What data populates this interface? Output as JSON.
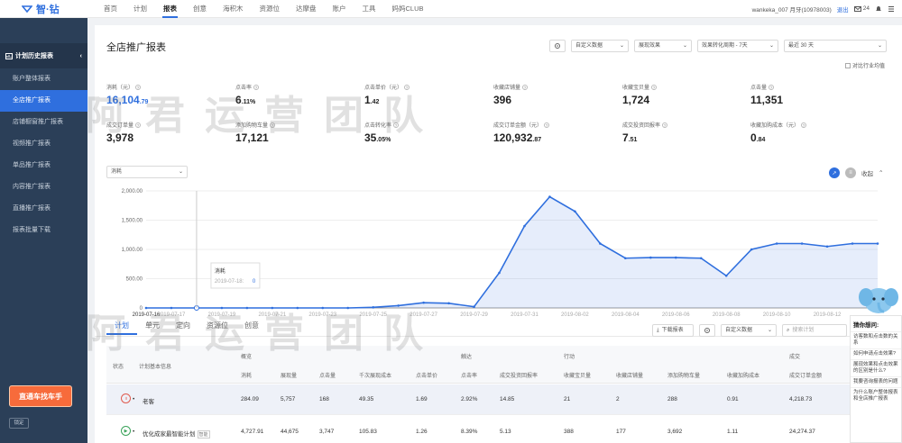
{
  "logo": {
    "text": "智·钻"
  },
  "nav": [
    "首页",
    "计划",
    "报表",
    "创意",
    "海积木",
    "资源位",
    "达摩盘",
    "账户",
    "工具",
    "妈妈CLUB"
  ],
  "nav_active": 2,
  "user": {
    "name": "wankeka_007 月牙(10978003)",
    "logout": "退出",
    "mail_count": "24"
  },
  "sidebar": {
    "heading": "计划历史报表",
    "items": [
      "账户整体报表",
      "全店推广报表",
      "店铺橱窗推广报表",
      "视频推广报表",
      "单品推广报表",
      "内容推广报表",
      "直播推广报表",
      "报表批量下载"
    ],
    "active": 1,
    "promo": "直通车找车手",
    "lock": "锁定"
  },
  "page": {
    "title": "全店推广报表",
    "compare_label": "对比行业均值"
  },
  "controls": {
    "custom_data": "自定义数据",
    "effect": "展现效果",
    "conversion_period": "效果转化周期 - 7天",
    "date_range": "最近 30 天"
  },
  "metrics": [
    {
      "label": "消耗（元）",
      "int": "16,104",
      "dec": ".79",
      "highlight": true
    },
    {
      "label": "点击率",
      "int": "6",
      "dec": ".11%"
    },
    {
      "label": "点击单价（元）",
      "int": "1",
      "dec": ".42"
    },
    {
      "label": "收藏店铺量",
      "int": "396",
      "dec": ""
    },
    {
      "label": "收藏宝贝量",
      "int": "1,724",
      "dec": ""
    },
    {
      "label": "点击量",
      "int": "11,351",
      "dec": ""
    },
    {
      "label": "成交订单量",
      "int": "3,978",
      "dec": ""
    },
    {
      "label": "添加购物车量",
      "int": "17,121",
      "dec": ""
    },
    {
      "label": "点击转化率",
      "int": "35",
      "dec": ".05%"
    },
    {
      "label": "成交订单金额（元）",
      "int": "120,932",
      "dec": ".87"
    },
    {
      "label": "成交投资回报率",
      "int": "7",
      "dec": ".51"
    },
    {
      "label": "收藏加购成本（元）",
      "int": "0",
      "dec": ".84"
    }
  ],
  "chart_select": "消耗",
  "chart_collapse": "收起",
  "chart_data": {
    "type": "line",
    "ylim": [
      0,
      2000
    ],
    "yticks": [
      "2,000.00",
      "1,500.00",
      "1,000.00",
      "500.00",
      "0"
    ],
    "x": [
      "2019-07-16",
      "2019-07-17",
      "2019-07-18",
      "2019-07-19",
      "2019-07-20",
      "2019-07-21",
      "2019-07-22",
      "2019-07-23",
      "2019-07-24",
      "2019-07-25",
      "2019-07-26",
      "2019-07-27",
      "2019-07-28",
      "2019-07-29",
      "2019-07-30",
      "2019-07-31",
      "2019-08-01",
      "2019-08-02",
      "2019-08-03",
      "2019-08-04",
      "2019-08-05",
      "2019-08-06",
      "2019-08-07",
      "2019-08-08",
      "2019-08-09",
      "2019-08-10",
      "2019-08-11",
      "2019-08-12",
      "2019-08-13",
      "2019-08-14"
    ],
    "xtick_labels": [
      "2019-07-16",
      "2019-07-17",
      "2019-07-19",
      "2019-07-21",
      "2019-07-23",
      "2019-07-25",
      "2019-07-27",
      "2019-07-29",
      "2019-07-31",
      "2019-08-02",
      "2019-08-04",
      "2019-08-06",
      "2019-08-08",
      "2019-08-10",
      "2019-08-12"
    ],
    "series": [
      {
        "values": [
          0,
          0,
          0,
          0,
          0,
          0,
          0,
          0,
          0,
          10,
          40,
          90,
          80,
          20,
          600,
          1400,
          1900,
          1650,
          1100,
          850,
          860,
          860,
          850,
          550,
          1000,
          1100,
          1100,
          1050,
          1100,
          1100
        ]
      }
    ],
    "tooltip": {
      "label": "消耗",
      "date": "2019-07-18:",
      "value": "0"
    }
  },
  "tabs": [
    "计划",
    "单元",
    "定向",
    "资源位",
    "创意"
  ],
  "tabs_active": 0,
  "table_controls": {
    "download": "下载报表",
    "custom": "自定义数据",
    "search_placeholder": "搜索计划"
  },
  "table": {
    "groups": [
      "概览",
      "触达",
      "行动",
      "成交"
    ],
    "headers": [
      "状态",
      "计划基本信息",
      "消耗",
      "展现量",
      "点击量",
      "千次展现成本",
      "点击单价",
      "点击率",
      "成交投资回报率",
      "收藏宝贝量",
      "收藏店铺量",
      "添加购物车量",
      "收藏加购成本",
      "成交订单金额"
    ],
    "rows": [
      {
        "status": "paused",
        "name": "老客",
        "tag": "",
        "values": [
          "284.09",
          "5,757",
          "168",
          "49.35",
          "1.69",
          "2.92%",
          "14.85",
          "21",
          "2",
          "288",
          "0.91",
          "4,218.73"
        ]
      },
      {
        "status": "running",
        "name": "优化成家最智能计划",
        "tag": "智能",
        "values": [
          "4,727.91",
          "44,675",
          "3,747",
          "105.83",
          "1.26",
          "8.39%",
          "5.13",
          "388",
          "177",
          "3,692",
          "1.11",
          "24,274.37"
        ]
      }
    ]
  },
  "help": {
    "title": "猜你想问:",
    "questions": [
      "访客数和点击数的关系",
      "如何申请点击效果?",
      "展现效果和点击效果的区别是什么?",
      "我要咨询报表的问题",
      "为什么账户整体报表和全店推广报表"
    ]
  },
  "watermark": "阿君运营团队"
}
